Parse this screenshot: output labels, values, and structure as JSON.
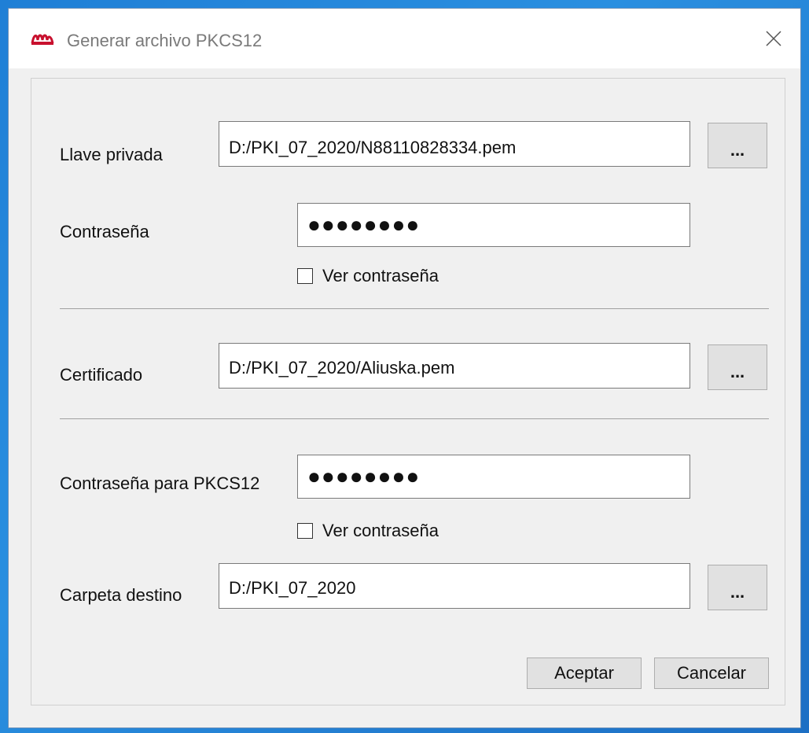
{
  "window": {
    "title": "Generar archivo PKCS12",
    "app_icon": "app-logo-icon",
    "close_icon": "close-icon"
  },
  "private_key": {
    "label": "Llave privada",
    "value": "D:/PKI_07_2020/N88110828334.pem",
    "browse_label": "..."
  },
  "password": {
    "label": "Contraseña",
    "value": "●●●●●●●●",
    "show_label": "Ver contraseña"
  },
  "certificate": {
    "label": "Certificado",
    "value": "D:/PKI_07_2020/Aliuska.pem",
    "browse_label": "..."
  },
  "pkcs12_password": {
    "label": "Contraseña para PKCS12",
    "value": "●●●●●●●●",
    "show_label": "Ver contraseña"
  },
  "destination": {
    "label": "Carpeta destino",
    "value": "D:/PKI_07_2020",
    "browse_label": "..."
  },
  "buttons": {
    "accept": "Aceptar",
    "cancel": "Cancelar"
  },
  "colors": {
    "desktop": "#1f7fd6",
    "dialog_bg": "#f0f0f0",
    "logo_red": "#c8102e"
  }
}
